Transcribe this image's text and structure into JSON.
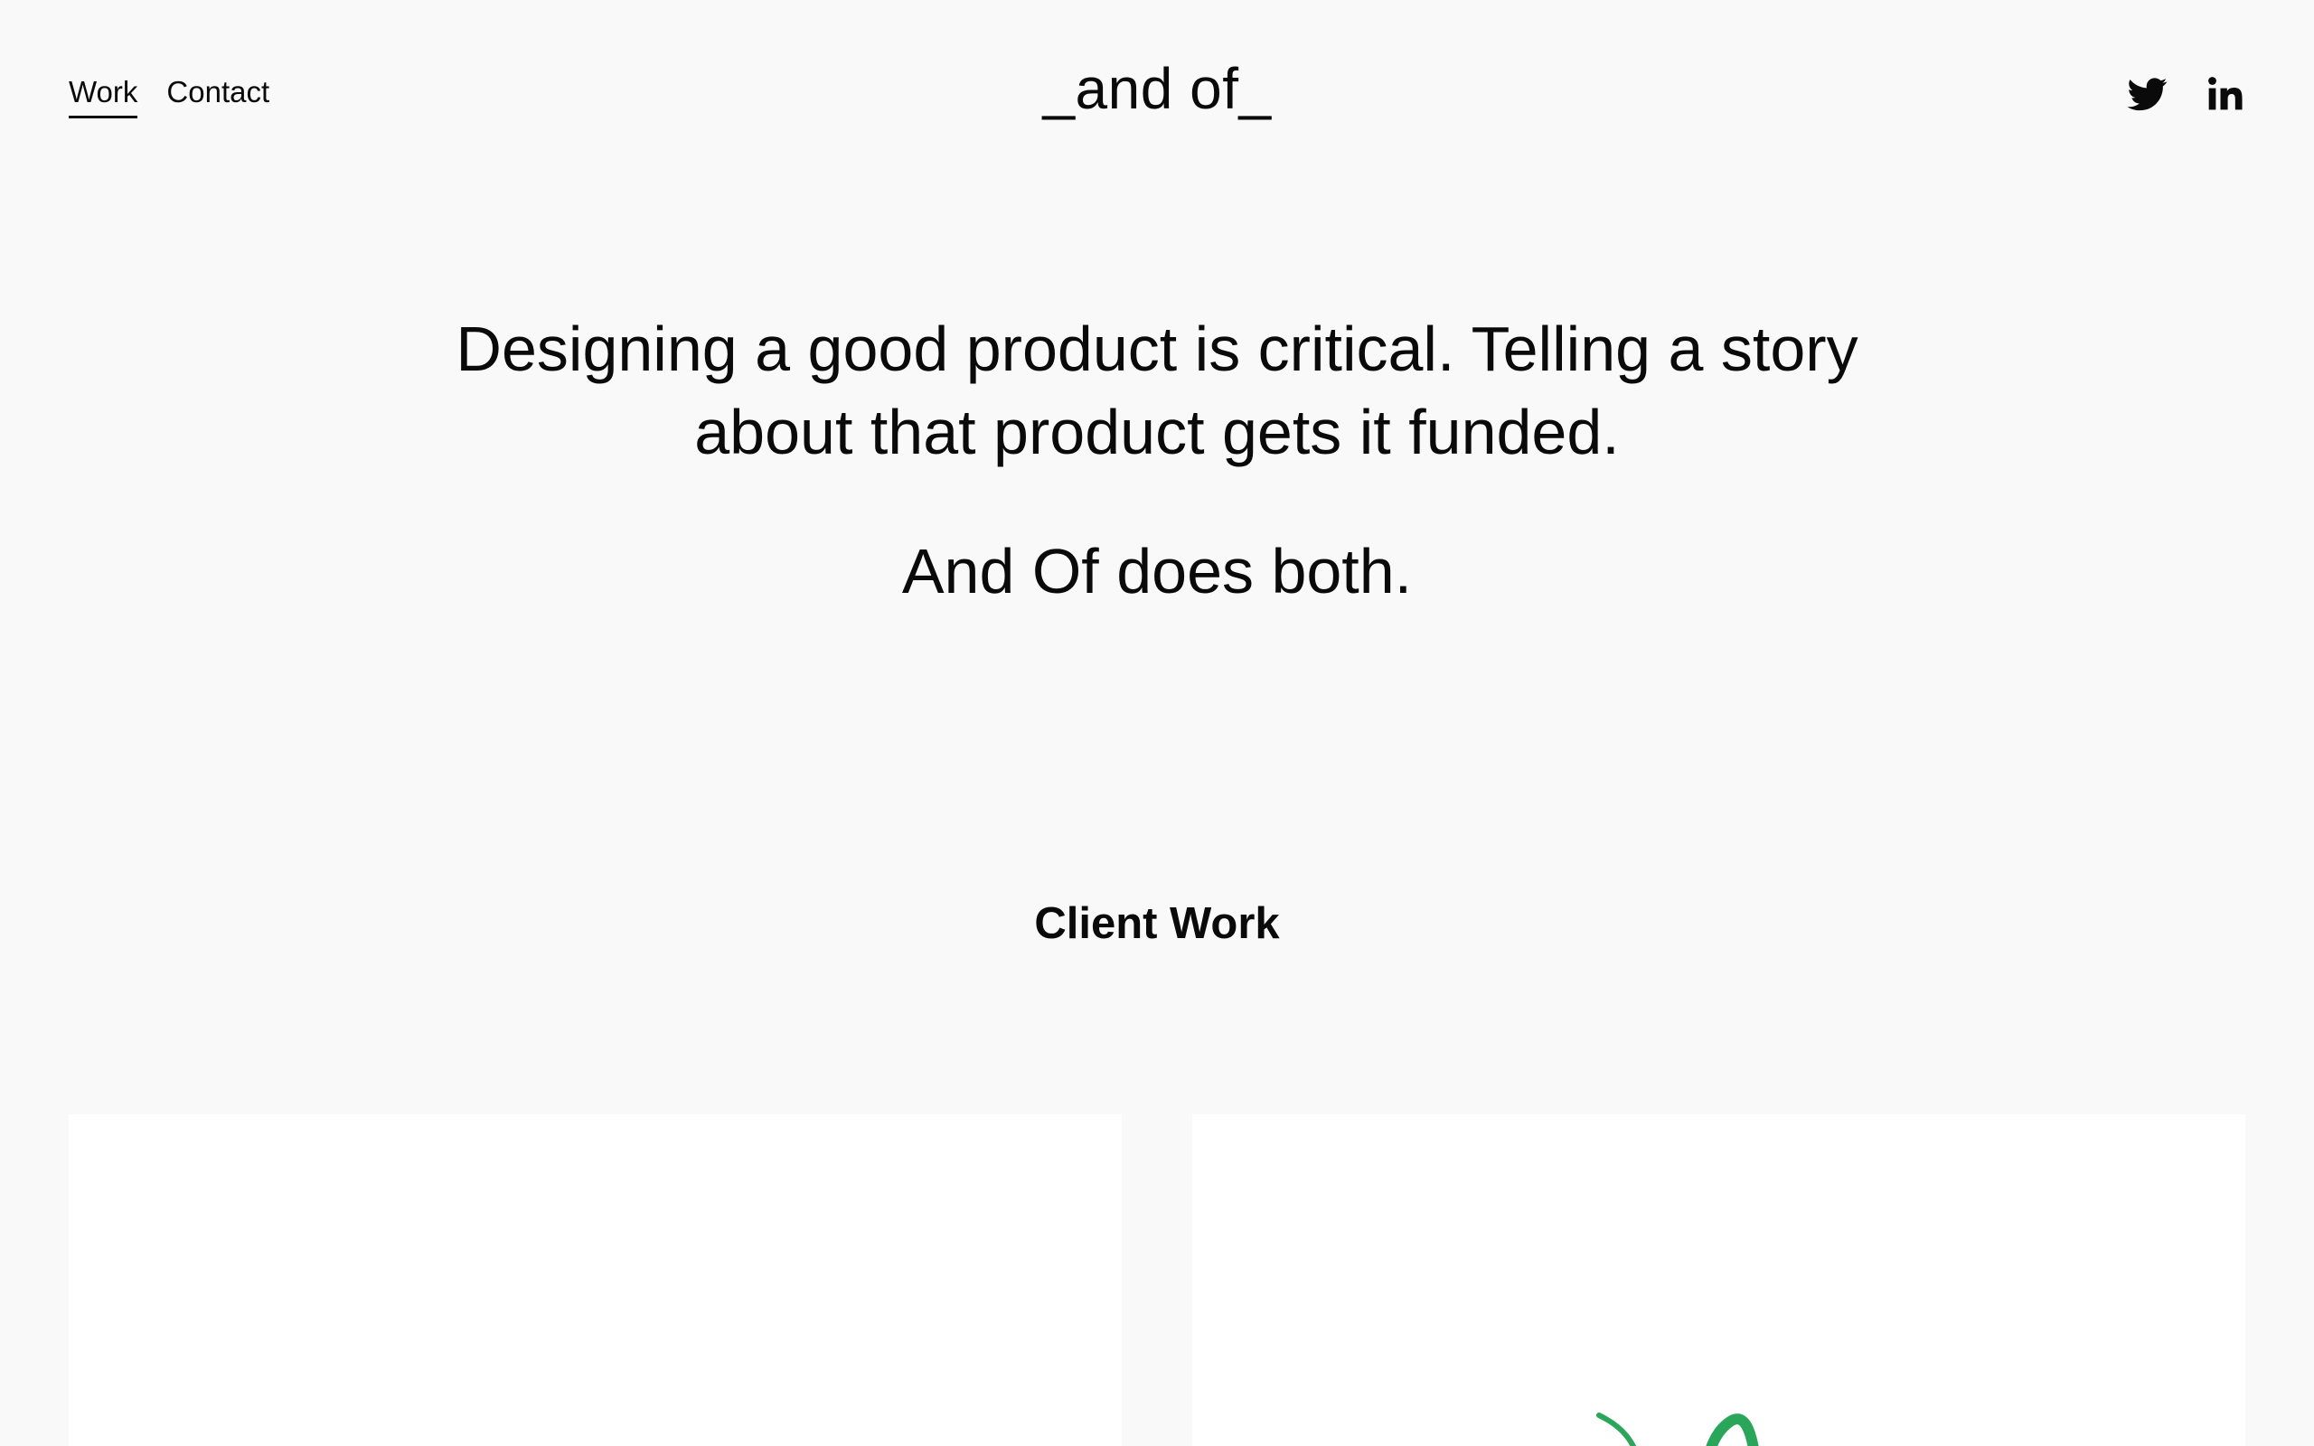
{
  "nav": {
    "items": [
      {
        "label": "Work",
        "active": true
      },
      {
        "label": "Contact",
        "active": false
      }
    ]
  },
  "logo": {
    "text": "_and of_"
  },
  "social": {
    "twitter_icon": "twitter-icon",
    "linkedin_icon": "linkedin-icon"
  },
  "hero": {
    "statement": "Designing a good product is critical. Telling a story about that product gets it funded.",
    "tagline": "And Of does both."
  },
  "section": {
    "title": "Client Work"
  },
  "colors": {
    "background": "#f9f9f9",
    "text": "#0a0a0a",
    "card": "#ffffff",
    "accent_green": "#2aa65a"
  }
}
